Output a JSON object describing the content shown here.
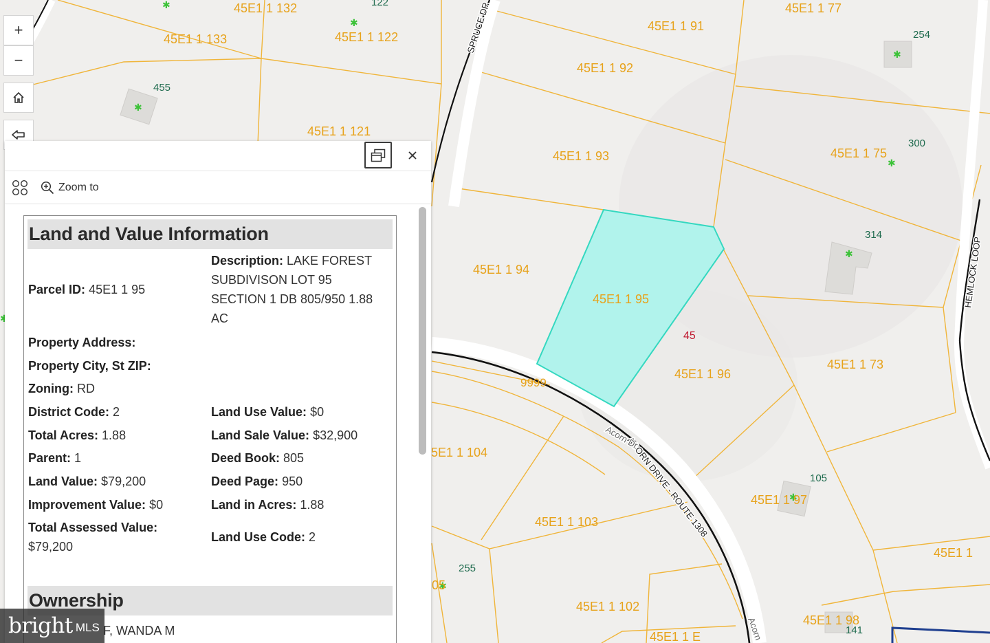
{
  "map": {
    "parcel_labels": [
      "45E1 1  132",
      "45E1 1  133",
      "45E1 1  122",
      "45E1 1  121",
      "45E1 1  77",
      "45E1 1  91",
      "45E1 1  92",
      "45E1 1  93",
      "45E1 1  75",
      "45E1 1  94",
      "45E1 1  95",
      "45E1 1  96",
      "45E1 1  73",
      "5E1 1  104",
      "45E1 1  103",
      "45E1 1  97",
      "45E1 1",
      "45E1 1  102",
      "45E1 1  98",
      "45E1 1  E"
    ],
    "address_labels": [
      "455",
      "122",
      "254",
      "300",
      "314",
      "105",
      "255",
      "141"
    ],
    "misc_labels": [
      "45",
      "9999",
      "05"
    ],
    "road_labels": [
      "SPRUCE DR",
      "ACORN DRIVE - ROUTE 1308",
      "Acorn Dr",
      "HEMLOCK LOOP",
      "Acorn"
    ],
    "selected_parcel": "45E1 1  95",
    "colors": {
      "parcel_line": "#f0b53a",
      "parcel_label": "#e7a21a",
      "address_label": "#1f6b4e",
      "selection_fill": "#b1f3ec",
      "selection_stroke": "#34d8c0"
    }
  },
  "controls": {
    "zoom_in": "+",
    "zoom_out": "−"
  },
  "panel": {
    "toolbar": {
      "zoom_to": "Zoom to"
    },
    "sections": {
      "land_value": "Land and Value Information",
      "ownership": "Ownership"
    },
    "fields": {
      "parcel_id": {
        "label": "Parcel ID:",
        "value": "45E1 1 95"
      },
      "description": {
        "label": "Description:",
        "value_lines": [
          "LAKE FOREST",
          "SUBDIVISON LOT 95",
          "SECTION 1 DB 805/950 1.88",
          "AC"
        ]
      },
      "property_address": {
        "label": "Property Address:",
        "value": ""
      },
      "property_city": {
        "label": "Property City, St ZIP:",
        "value": ""
      },
      "zoning": {
        "label": "Zoning:",
        "value": "RD"
      },
      "district_code": {
        "label": "District Code:",
        "value": "2"
      },
      "land_use_value": {
        "label": "Land Use Value:",
        "value": "$0"
      },
      "total_acres": {
        "label": "Total Acres:",
        "value": "1.88"
      },
      "land_sale_value": {
        "label": "Land Sale Value:",
        "value": "$32,900"
      },
      "parent": {
        "label": "Parent:",
        "value": "1"
      },
      "deed_book": {
        "label": "Deed Book:",
        "value": "805"
      },
      "land_value": {
        "label": "Land Value:",
        "value": "$79,200"
      },
      "deed_page": {
        "label": "Deed Page:",
        "value": "950"
      },
      "improvement_value": {
        "label": "Improvement Value:",
        "value": "$0"
      },
      "land_in_acres": {
        "label": "Land in Acres:",
        "value": "1.88"
      },
      "total_assessed": {
        "label": "Total Assessed Value:",
        "value": "$79,200"
      },
      "land_use_code": {
        "label": "Land Use Code:",
        "value": "2"
      }
    },
    "owner_partial": "F, WANDA M"
  },
  "watermark": {
    "brand": "bright",
    "suffix": "MLS"
  }
}
